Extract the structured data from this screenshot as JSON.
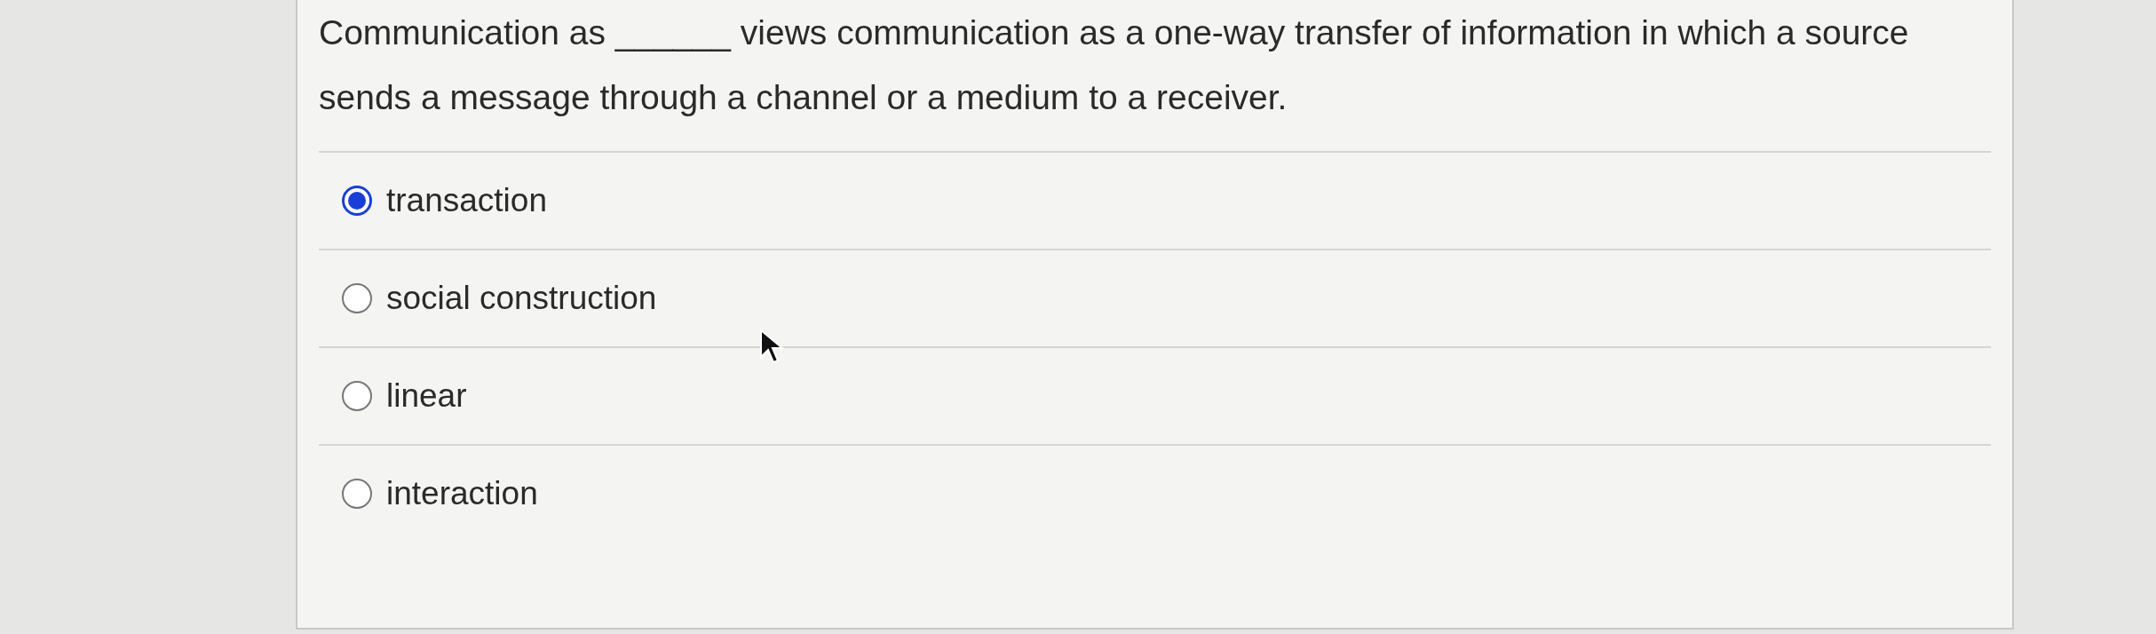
{
  "question": {
    "text": "Communication as ______ views communication as a one-way transfer of information in which a source sends a message through a channel or a medium to a receiver."
  },
  "options": [
    {
      "label": "transaction",
      "selected": true
    },
    {
      "label": "social construction",
      "selected": false
    },
    {
      "label": "linear",
      "selected": false
    },
    {
      "label": "interaction",
      "selected": false
    }
  ]
}
